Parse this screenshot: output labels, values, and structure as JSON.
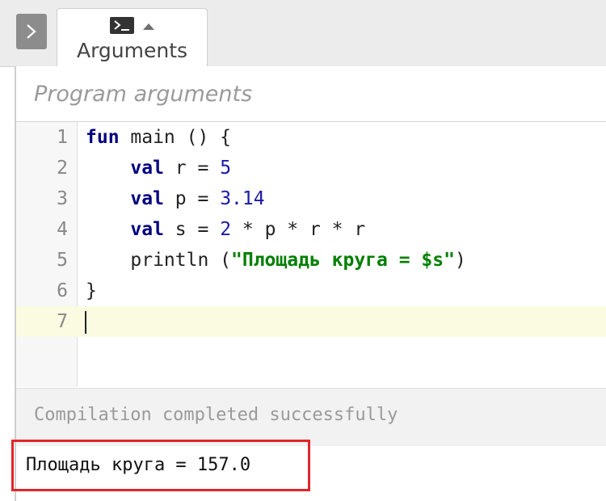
{
  "toolbar": {
    "expand_icon": "chevron-right-icon",
    "tab": {
      "label": "Arguments",
      "icon": "terminal-icon",
      "caret_icon": "caret-up-icon"
    }
  },
  "arguments": {
    "placeholder": "Program arguments",
    "value": ""
  },
  "editor": {
    "line_numbers": [
      "1",
      "2",
      "3",
      "4",
      "5",
      "6",
      "7"
    ],
    "tokens": {
      "l1_kw": "fun",
      "l1_rest": " main () {",
      "l2_indent": "    ",
      "l2_kw": "val",
      "l2_mid": " r = ",
      "l2_num": "5",
      "l3_indent": "    ",
      "l3_kw": "val",
      "l3_mid": " p = ",
      "l3_num": "3.14",
      "l4_indent": "    ",
      "l4_kw": "val",
      "l4_mid": " s = ",
      "l4_num": "2",
      "l4_rest": " * p * r * r",
      "l5_pre": "    println (",
      "l5_str": "\"Площадь круга = $s\"",
      "l5_post": ")",
      "l6": "}"
    },
    "active_line": 7
  },
  "status": {
    "text": "Compilation completed successfully"
  },
  "output": {
    "text": "Площадь круга = 157.0"
  },
  "colors": {
    "keyword": "#000080",
    "number": "#1a1aa6",
    "string": "#008000",
    "highlight_border": "#e0262a",
    "active_line_bg": "#fbfbe2"
  }
}
